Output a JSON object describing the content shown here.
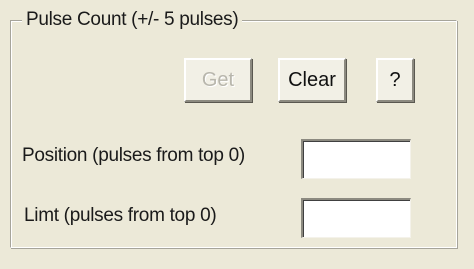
{
  "group": {
    "title": "Pulse Count (+/- 5 pulses)"
  },
  "buttons": {
    "get_label": "Get",
    "clear_label": "Clear",
    "help_label": "?"
  },
  "fields": {
    "position": {
      "label": "Position (pulses from top 0)",
      "value": ""
    },
    "limit": {
      "label": "Limt (pulses from top 0)",
      "value": ""
    }
  }
}
